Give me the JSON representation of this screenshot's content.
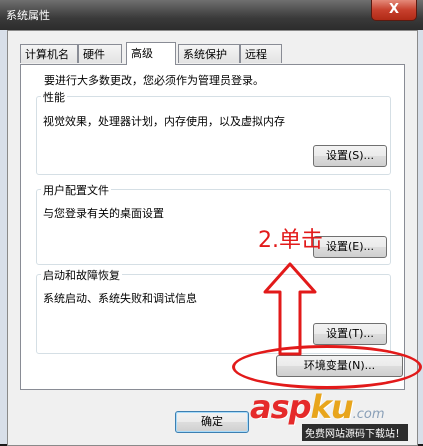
{
  "window": {
    "title": "系统属性",
    "close": "X"
  },
  "tabs": [
    {
      "label": "计算机名"
    },
    {
      "label": "硬件"
    },
    {
      "label": "高级"
    },
    {
      "label": "系统保护"
    },
    {
      "label": "远程"
    }
  ],
  "admin_note": "要进行大多数更改，您必须作为管理员登录。",
  "performance": {
    "title": "性能",
    "desc": "视觉效果，处理器计划，内存使用，以及虚拟内存",
    "button": "设置(S)..."
  },
  "user_profiles": {
    "title": "用户配置文件",
    "desc": "与您登录有关的桌面设置",
    "button": "设置(E)..."
  },
  "startup": {
    "title": "启动和故障恢复",
    "desc": "系统启动、系统失败和调试信息",
    "button": "设置(T)..."
  },
  "env_button": "环境变量(N)...",
  "ok_button": "确定",
  "annotation": {
    "step": "2.单击",
    "color": "#e21a1a"
  },
  "watermark": {
    "asp": "asp",
    "ku": "ku",
    "com": ".com",
    "sub": "免费网站源码下载站！"
  }
}
